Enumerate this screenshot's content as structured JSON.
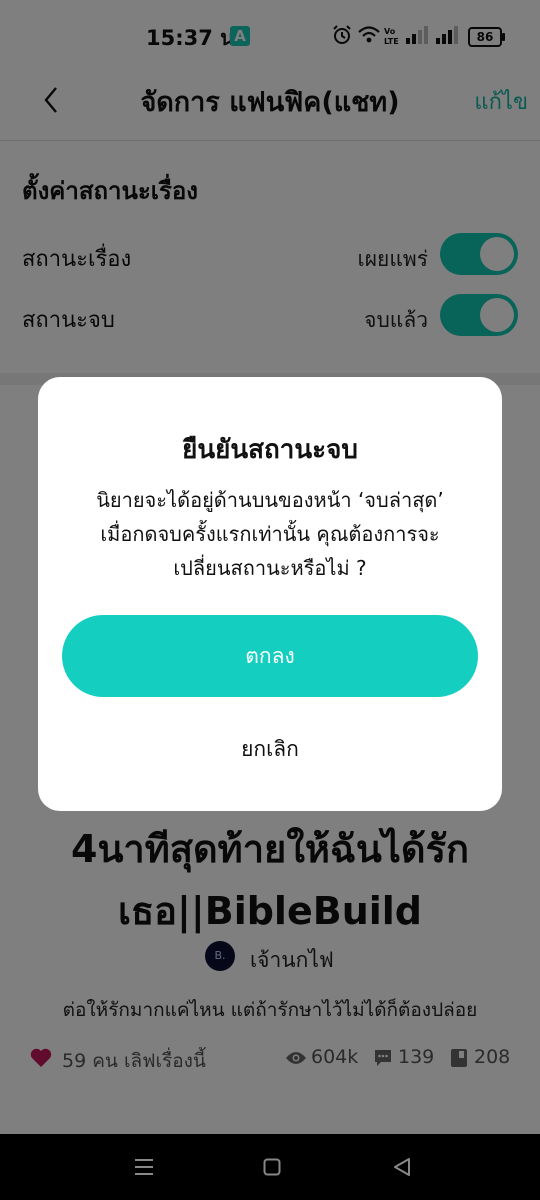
{
  "status_bar": {
    "time": "15:37 น.",
    "app_badge": "A",
    "battery": "86"
  },
  "header": {
    "title": "จัดการ แฟนฟิค(แชท)",
    "edit_label": "แก้ไข"
  },
  "settings": {
    "title": "ตั้งค่าสถานะเรื่อง",
    "rows": [
      {
        "label": "สถานะเรื่อง",
        "value": "เผยแพร่",
        "on": true
      },
      {
        "label": "สถานะจบ",
        "value": "จบแล้ว",
        "on": true
      }
    ]
  },
  "dialog": {
    "title": "ยืนยันสถานะจบ",
    "message_lines": [
      "นิยายจะได้อยู่ด้านบนของหน้า ‘จบล่าสุด’",
      "เมื่อกดจบครั้งแรกเท่านั้น คุณต้องการจะ",
      "เปลี่ยนสถานะหรือไม่ ?"
    ],
    "ok_label": "ตกลง",
    "cancel_label": "ยกเลิก"
  },
  "story": {
    "title_lines": [
      "4นาทีสุดท้ายให้ฉันได้รัก",
      "เธอ||BibleBuild"
    ],
    "author_avatar_text": "B.",
    "author": "เจ้านกไฟ",
    "description": "ต่อให้รักมากแค่ไหน แต่ถ้ารักษาไว้ไม่ได้ก็ต้องปล่อย",
    "likes": "59 คน เลิฟเรื่องนี้",
    "views": "604k",
    "comments": "139",
    "chapters": "208"
  },
  "colors": {
    "accent": "#14cec0",
    "toggle": "#10c7b3",
    "heart": "#c2185b"
  }
}
